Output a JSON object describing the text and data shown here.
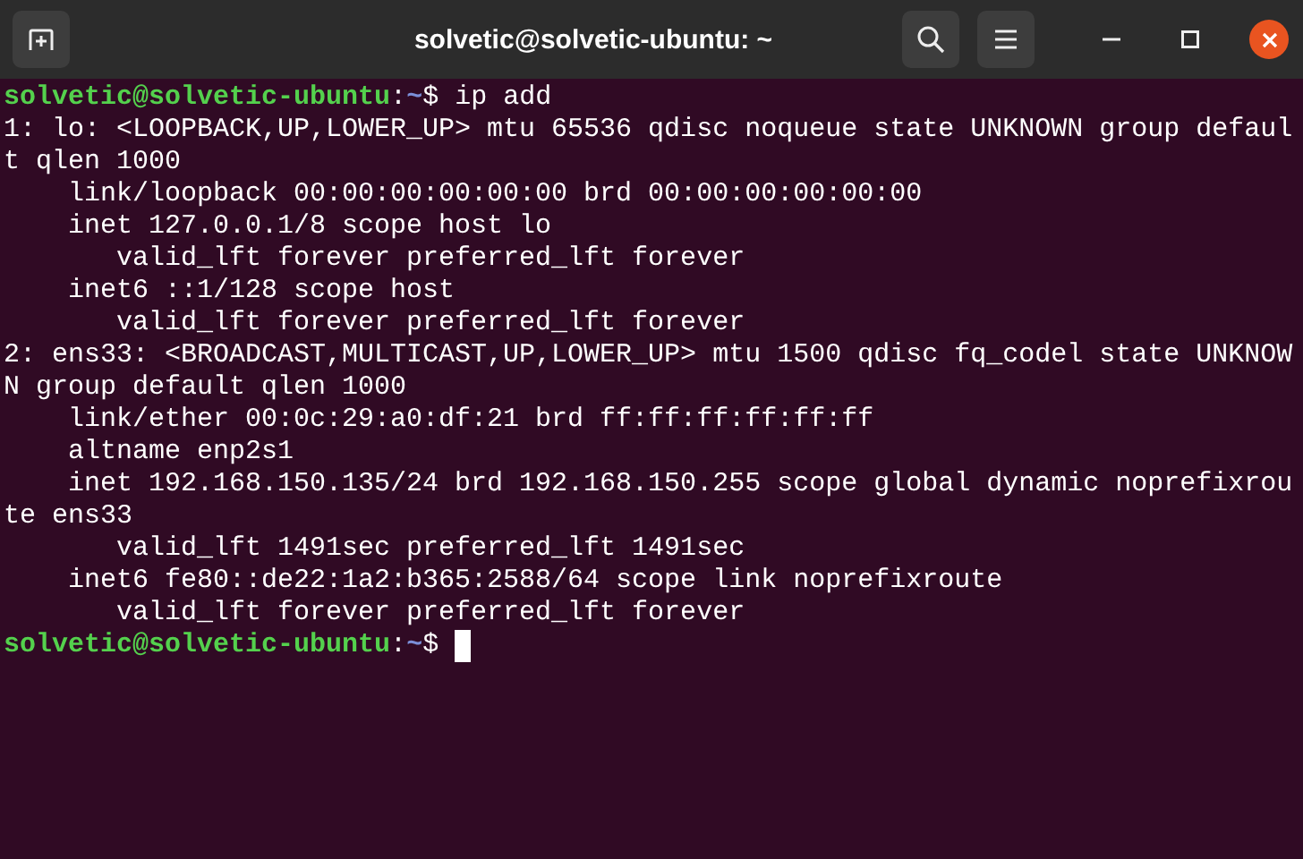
{
  "window": {
    "title": "solvetic@solvetic-ubuntu: ~"
  },
  "terminal": {
    "lines": [
      {
        "kind": "prompt",
        "user_host": "solvetic@solvetic-ubuntu",
        "separator": ":",
        "path": "~",
        "symbol": "$ ",
        "command": "ip add",
        "cursor": false
      },
      {
        "kind": "output",
        "text": "1: lo: <LOOPBACK,UP,LOWER_UP> mtu 65536 qdisc noqueue state UNKNOWN group defaul"
      },
      {
        "kind": "output",
        "text": "t qlen 1000"
      },
      {
        "kind": "output",
        "text": "    link/loopback 00:00:00:00:00:00 brd 00:00:00:00:00:00"
      },
      {
        "kind": "output",
        "text": "    inet 127.0.0.1/8 scope host lo"
      },
      {
        "kind": "output",
        "text": "       valid_lft forever preferred_lft forever"
      },
      {
        "kind": "output",
        "text": "    inet6 ::1/128 scope host"
      },
      {
        "kind": "output",
        "text": "       valid_lft forever preferred_lft forever"
      },
      {
        "kind": "output",
        "text": "2: ens33: <BROADCAST,MULTICAST,UP,LOWER_UP> mtu 1500 qdisc fq_codel state UNKNOW"
      },
      {
        "kind": "output",
        "text": "N group default qlen 1000"
      },
      {
        "kind": "output",
        "text": "    link/ether 00:0c:29:a0:df:21 brd ff:ff:ff:ff:ff:ff"
      },
      {
        "kind": "output",
        "text": "    altname enp2s1"
      },
      {
        "kind": "output",
        "text": "    inet 192.168.150.135/24 brd 192.168.150.255 scope global dynamic noprefixrou"
      },
      {
        "kind": "output",
        "text": "te ens33"
      },
      {
        "kind": "output",
        "text": "       valid_lft 1491sec preferred_lft 1491sec"
      },
      {
        "kind": "output",
        "text": "    inet6 fe80::de22:1a2:b365:2588/64 scope link noprefixroute"
      },
      {
        "kind": "output",
        "text": "       valid_lft forever preferred_lft forever"
      },
      {
        "kind": "prompt",
        "user_host": "solvetic@solvetic-ubuntu",
        "separator": ":",
        "path": "~",
        "symbol": "$ ",
        "cursor": true
      }
    ]
  }
}
